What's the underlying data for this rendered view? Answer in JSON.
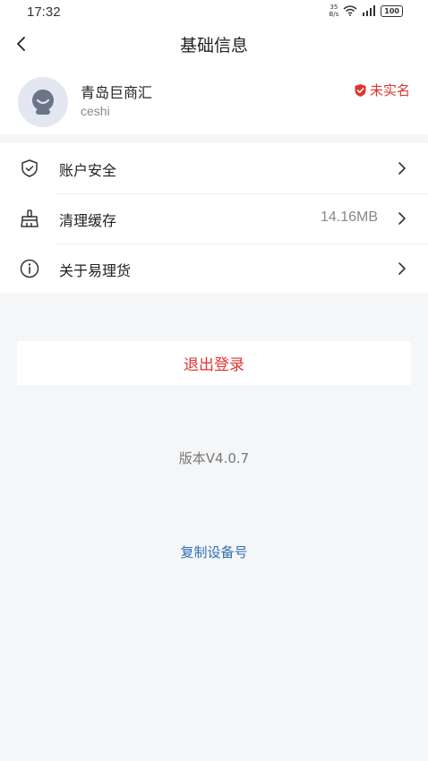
{
  "status_bar": {
    "time": "17:32",
    "net_speed_value": "35",
    "net_speed_unit": "B/s",
    "battery": "100"
  },
  "nav": {
    "title": "基础信息",
    "back_icon": "chevron-left-icon"
  },
  "profile": {
    "name": "青岛巨商汇",
    "username": "ceshi",
    "verify_status": "未实名",
    "verify_color": "#e0332e"
  },
  "menu": {
    "items": [
      {
        "label": "账户安全",
        "value": "",
        "icon": "shield-icon"
      },
      {
        "label": "清理缓存",
        "value": "14.16MB",
        "icon": "broom-icon"
      },
      {
        "label": "关于易理货",
        "value": "",
        "icon": "info-icon"
      }
    ]
  },
  "logout_label": "退出登录",
  "version": "版本V4.0.7",
  "copy_device_label": "复制设备号",
  "colors": {
    "accent_red": "#e0332e",
    "link_blue": "#2f6fb3",
    "background": "#f5f6f8"
  }
}
